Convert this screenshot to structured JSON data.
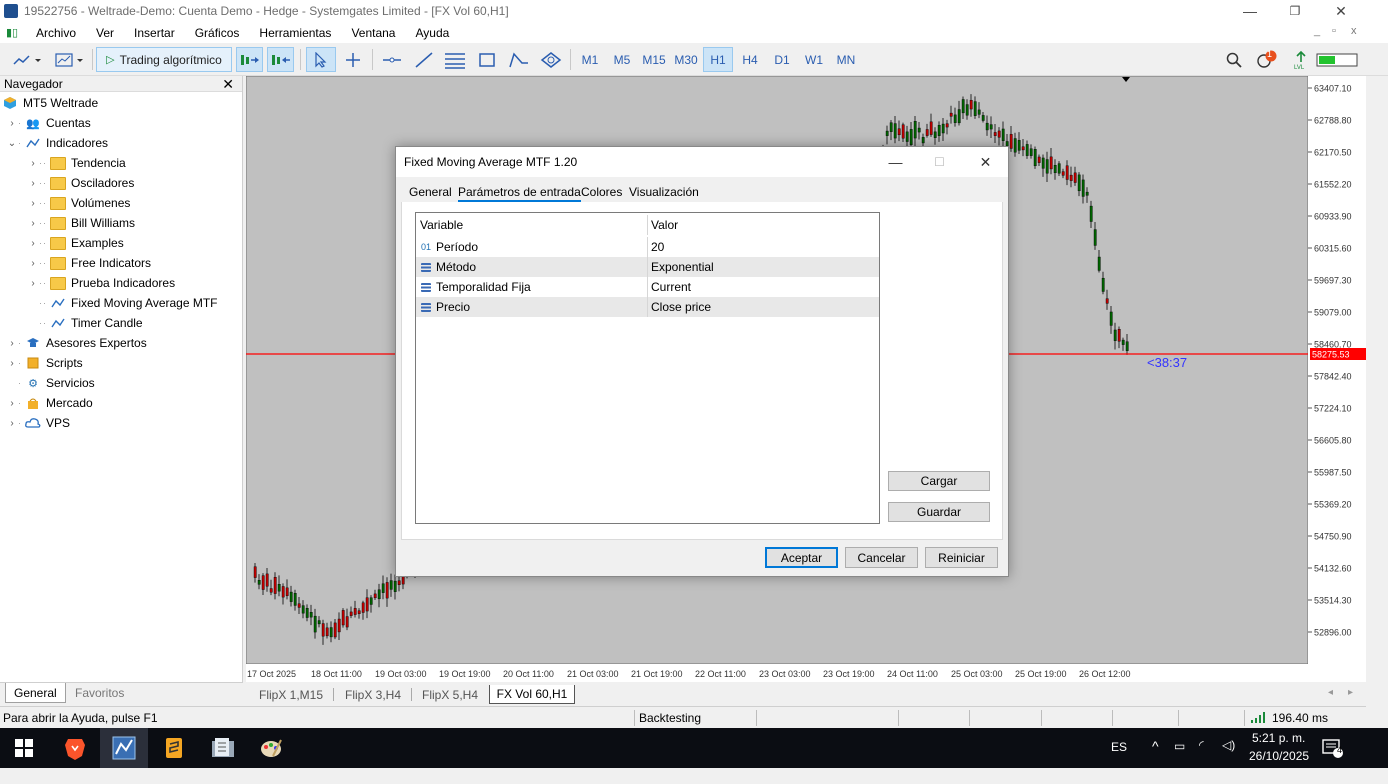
{
  "window": {
    "title": "19522756 - Weltrade-Demo: Cuenta Demo - Hedge - Systemgates Limited - [FX Vol 60,H1]",
    "minimize": "—",
    "maximize": "❐",
    "close": "✕"
  },
  "menu": {
    "items": [
      "Archivo",
      "Ver",
      "Insertar",
      "Gráficos",
      "Herramientas",
      "Ventana",
      "Ayuda"
    ],
    "mdi_controls": [
      "_",
      "▫",
      "x"
    ]
  },
  "toolbar": {
    "algo_label": "Trading algorítmico",
    "timeframes": [
      "M1",
      "M5",
      "M15",
      "M30",
      "H1",
      "H4",
      "D1",
      "W1",
      "MN"
    ],
    "active_timeframe": "H1",
    "notification_count": "1",
    "icons": [
      "line-chart-icon",
      "template-icon",
      "play-icon",
      "autoscroll-icon",
      "chart-shift-icon",
      "cursor-icon",
      "crosshair-icon",
      "horizontal-line-icon",
      "trendline-icon",
      "channel-icon",
      "rectangle-icon",
      "fibo-icon",
      "shapes-icon",
      "search-icon",
      "notification-icon",
      "signal-icon",
      "battery-icon"
    ]
  },
  "navigator": {
    "title": "Navegador",
    "close": "✕",
    "items": [
      {
        "label": "MT5 Weltrade",
        "icon": "terminal-icon"
      },
      {
        "label": "Cuentas",
        "icon": "accounts-icon"
      },
      {
        "label": "Indicadores",
        "icon": "indicators-icon"
      },
      {
        "label": "Tendencia",
        "icon": "folder-icon"
      },
      {
        "label": "Osciladores",
        "icon": "folder-icon"
      },
      {
        "label": "Volúmenes",
        "icon": "folder-icon"
      },
      {
        "label": "Bill Williams",
        "icon": "folder-icon"
      },
      {
        "label": "Examples",
        "icon": "folder-icon"
      },
      {
        "label": "Free Indicators",
        "icon": "folder-icon"
      },
      {
        "label": "Prueba Indicadores",
        "icon": "folder-icon"
      },
      {
        "label": "Fixed Moving Average MTF",
        "icon": "indicator-icon"
      },
      {
        "label": "Timer Candle",
        "icon": "indicator-icon"
      },
      {
        "label": "Asesores Expertos",
        "icon": "experts-icon"
      },
      {
        "label": "Scripts",
        "icon": "scripts-icon"
      },
      {
        "label": "Servicios",
        "icon": "services-icon"
      },
      {
        "label": "Mercado",
        "icon": "market-icon"
      },
      {
        "label": "VPS",
        "icon": "vps-icon"
      }
    ],
    "tabs": [
      "General",
      "Favoritos"
    ]
  },
  "chart": {
    "symbol_tab": "FX Vol 60,H1",
    "price_labels": [
      "63407.10",
      "62788.80",
      "62170.50",
      "61552.20",
      "60933.90",
      "60315.60",
      "59697.30",
      "59079.00",
      "58460.70",
      "57842.40",
      "57224.10",
      "56605.80",
      "55987.50",
      "55369.20",
      "54750.90",
      "54132.60",
      "53514.30",
      "52896.00"
    ],
    "current_price": "58275.53",
    "timer": "<38:37",
    "time_labels": [
      "17 Oct 2025",
      "18 Oct 11:00",
      "19 Oct 03:00",
      "19 Oct 19:00",
      "20 Oct 11:00",
      "21 Oct 03:00",
      "21 Oct 19:00",
      "22 Oct 11:00",
      "23 Oct 03:00",
      "23 Oct 19:00",
      "24 Oct 11:00",
      "25 Oct 03:00",
      "25 Oct 19:00",
      "26 Oct 12:00"
    ],
    "colors": {
      "background": "#c0c0c0",
      "bull": "#006400",
      "bear": "#c00000",
      "price_line": "#ff0000",
      "timer": "#3333ff"
    }
  },
  "chart_tabs": [
    "FlipX 1,M15",
    "FlipX 3,H4",
    "FlipX 5,H4",
    "FX Vol 60,H1"
  ],
  "statusbar": {
    "help": "Para abrir la Ayuda, pulse F1",
    "profile": "Backtesting",
    "ping": "196.40 ms"
  },
  "dialog": {
    "title": "Fixed Moving Average MTF 1.20",
    "tabs": [
      "General",
      "Parámetros de entrada",
      "Colores",
      "Visualización"
    ],
    "active_tab": "Parámetros de entrada",
    "table_headers": [
      "Variable",
      "Valor"
    ],
    "rows": [
      {
        "icon": "01",
        "variable": "Período",
        "value": "20"
      },
      {
        "icon": "enum",
        "variable": "Método",
        "value": "Exponential"
      },
      {
        "icon": "enum",
        "variable": "Temporalidad Fija",
        "value": "Current"
      },
      {
        "icon": "enum",
        "variable": "Precio",
        "value": "Close price"
      }
    ],
    "load_button": "Cargar",
    "save_button": "Guardar",
    "ok_button": "Aceptar",
    "cancel_button": "Cancelar",
    "reset_button": "Reiniciar"
  },
  "taskbar": {
    "language": "ES",
    "time": "5:21 p. m.",
    "date": "26/10/2025",
    "notification_badge": "4"
  }
}
